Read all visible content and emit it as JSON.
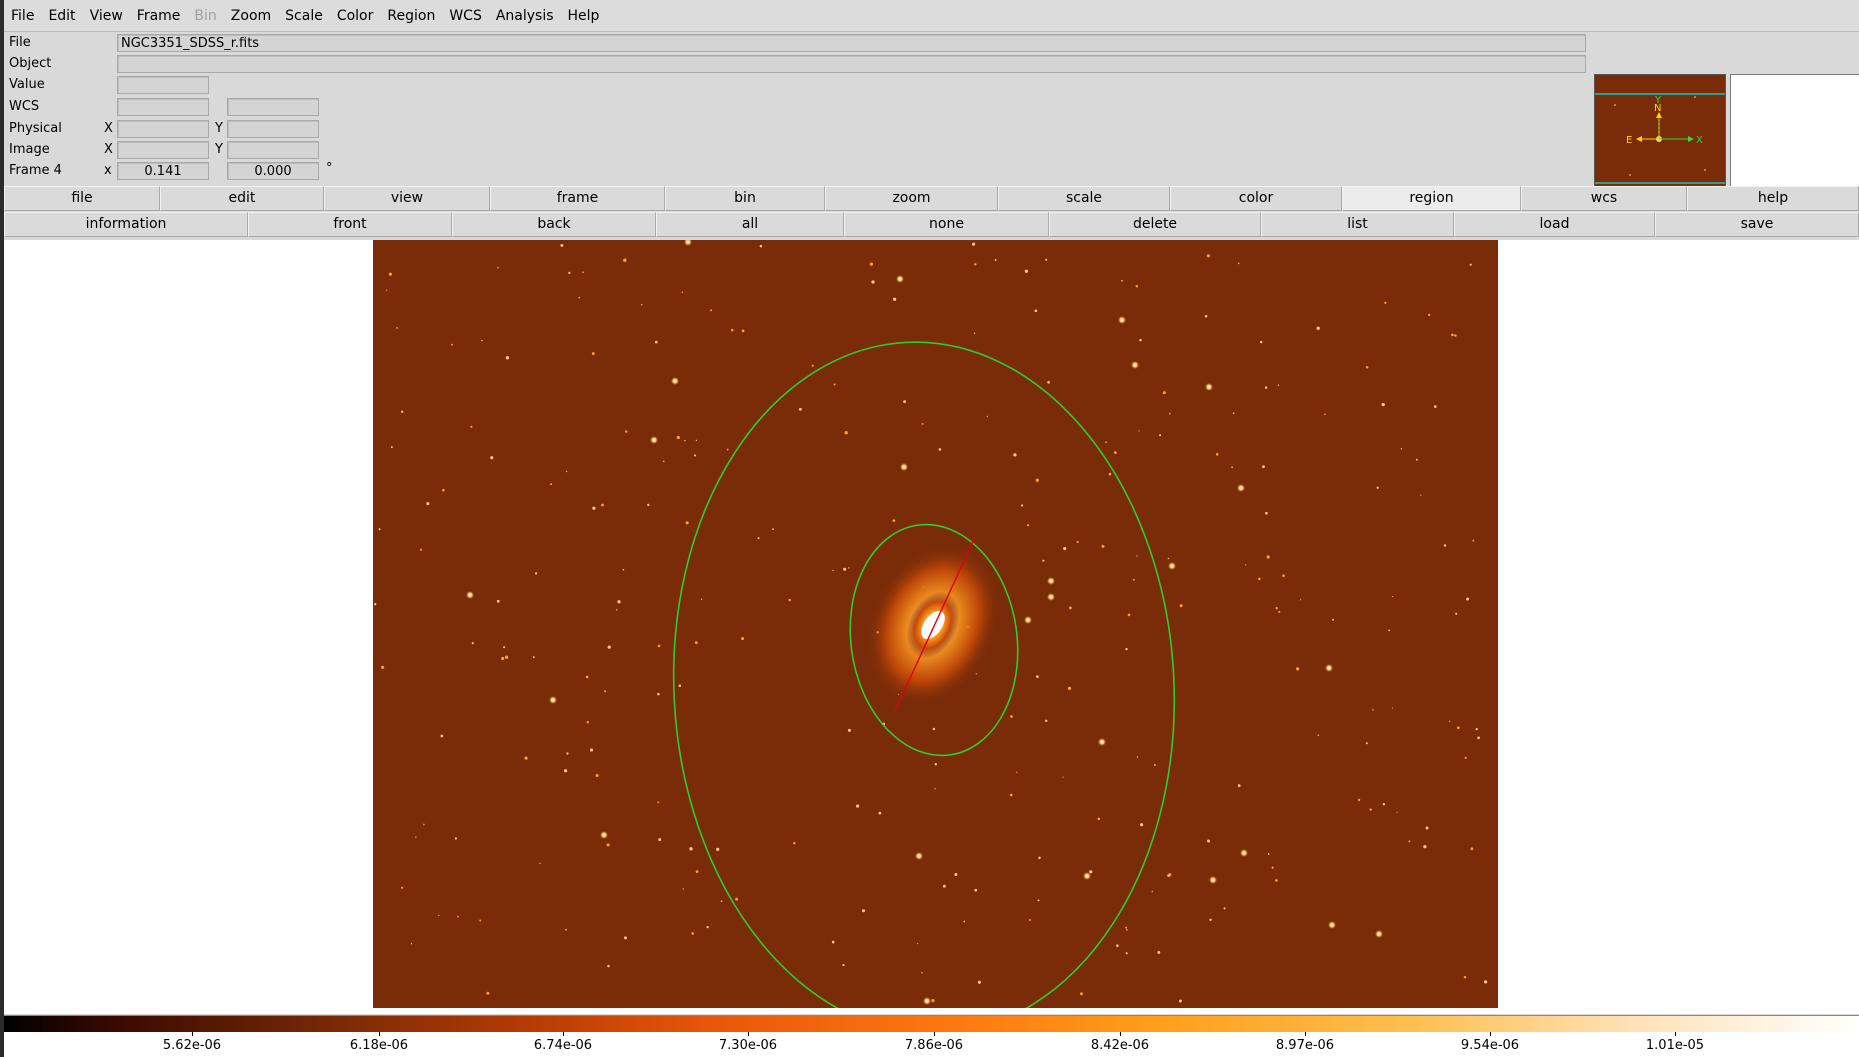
{
  "menubar": {
    "items": [
      {
        "label": "File",
        "enabled": true
      },
      {
        "label": "Edit",
        "enabled": true
      },
      {
        "label": "View",
        "enabled": true
      },
      {
        "label": "Frame",
        "enabled": true
      },
      {
        "label": "Bin",
        "enabled": false
      },
      {
        "label": "Zoom",
        "enabled": true
      },
      {
        "label": "Scale",
        "enabled": true
      },
      {
        "label": "Color",
        "enabled": true
      },
      {
        "label": "Region",
        "enabled": true
      },
      {
        "label": "WCS",
        "enabled": true
      },
      {
        "label": "Analysis",
        "enabled": true
      },
      {
        "label": "Help",
        "enabled": true
      }
    ]
  },
  "info": {
    "file_label": "File",
    "file_value": "NGC3351_SDSS_r.fits",
    "object_label": "Object",
    "object_value": "",
    "value_label": "Value",
    "value_value": "",
    "wcs_label": "WCS",
    "wcs_value1": "",
    "wcs_value2": "",
    "physical_label": "Physical",
    "physical_x_label": "X",
    "physical_y_label": "Y",
    "physical_x": "",
    "physical_y": "",
    "image_label": "Image",
    "image_x_label": "X",
    "image_y_label": "Y",
    "image_x": "",
    "image_y": "",
    "frame_label": "Frame 4",
    "frame_x_label": "x",
    "frame_zoom": "0.141",
    "frame_angle": "0.000",
    "frame_angle_unit": "°"
  },
  "panner": {
    "compass_n": "N",
    "compass_e": "E",
    "axis_x": "X",
    "axis_y": "Y"
  },
  "buttonbar_top": {
    "items": [
      "file",
      "edit",
      "view",
      "frame",
      "bin",
      "zoom",
      "scale",
      "color",
      "region",
      "wcs",
      "help"
    ],
    "active": "region"
  },
  "buttonbar_region": {
    "items": [
      "information",
      "front",
      "back",
      "all",
      "none",
      "delete",
      "list",
      "load",
      "save"
    ]
  },
  "colorbar": {
    "ticks": [
      "5.62e-06",
      "6.18e-06",
      "6.74e-06",
      "7.30e-06",
      "7.86e-06",
      "8.42e-06",
      "8.97e-06",
      "9.54e-06",
      "1.01e-05"
    ]
  },
  "colors": {
    "image_background": "#7a2c08",
    "region_ellipse": "#2ecc2e",
    "region_line": "#e0001a",
    "panner_box": "#00ffff"
  }
}
